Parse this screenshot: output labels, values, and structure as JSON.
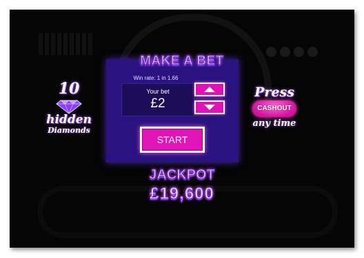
{
  "panel": {
    "title": "MAKE A BET",
    "win_rate": "Win rate: 1 in 1.66",
    "bet_label": "Your bet",
    "bet_value": "£2",
    "start_label": "START"
  },
  "left_promo": {
    "number": "10",
    "word1": "hidden",
    "word2": "Diamonds",
    "icon": "diamond-icon"
  },
  "right_promo": {
    "press": "Press",
    "cashout": "CASHOUT",
    "anytime": "any time"
  },
  "jackpot": {
    "label": "JACKPOT",
    "amount": "£19,600"
  },
  "colors": {
    "panel_bg": "#2a1380",
    "accent_magenta": "#e114b8",
    "text_lavender": "#d9b8ff",
    "background": "#050505"
  }
}
